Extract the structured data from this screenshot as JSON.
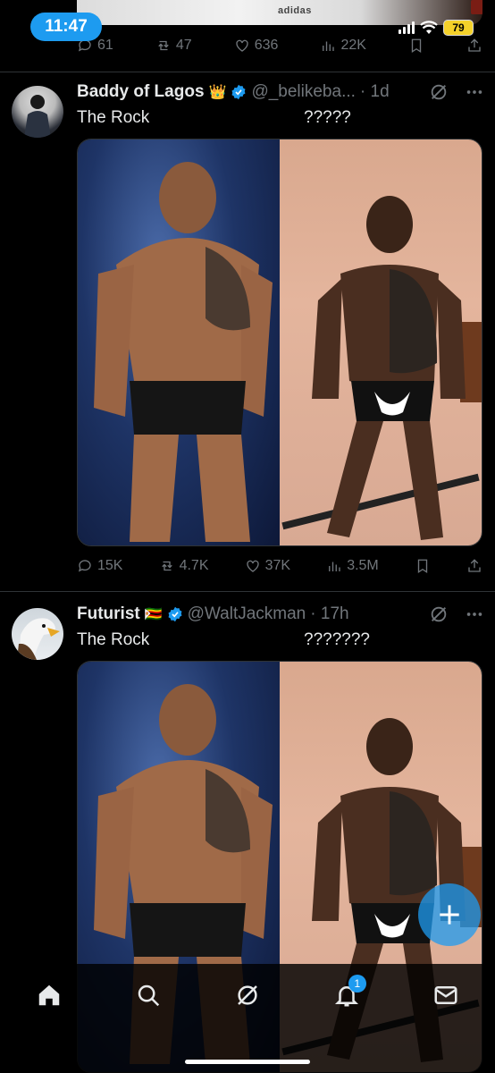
{
  "status_bar": {
    "time": "11:47",
    "battery": "79"
  },
  "top_media": {
    "brand_text": "adidas"
  },
  "top_actions": {
    "replies": "61",
    "reposts": "47",
    "likes": "636",
    "views": "22K"
  },
  "tweets": [
    {
      "display_name": "Baddy of Lagos",
      "name_emoji": "👑",
      "handle": "@_belikeba...",
      "time": "· 1d",
      "text_left": "The Rock",
      "text_right": "?????",
      "replies": "15K",
      "reposts": "4.7K",
      "likes": "37K",
      "views": "3.5M"
    },
    {
      "display_name": "Futurist",
      "name_emoji": "🇿🇼",
      "handle": "@WaltJackman",
      "time": "· 17h",
      "text_left": "The Rock",
      "text_right": "???????"
    }
  ],
  "bottom_nav": {
    "notifications_badge": "1"
  },
  "icons": [
    "reply-icon",
    "repost-icon",
    "like-icon",
    "views-icon",
    "bookmark-icon",
    "share-icon",
    "grok-icon",
    "more-icon",
    "verified-icon",
    "home-icon",
    "search-icon",
    "notifications-icon",
    "messages-icon",
    "compose-icon"
  ],
  "colors": {
    "accent": "#1d9bf0",
    "muted": "#71767b",
    "background": "#000000",
    "text": "#e7e9ea",
    "battery": "#f4d12a"
  }
}
